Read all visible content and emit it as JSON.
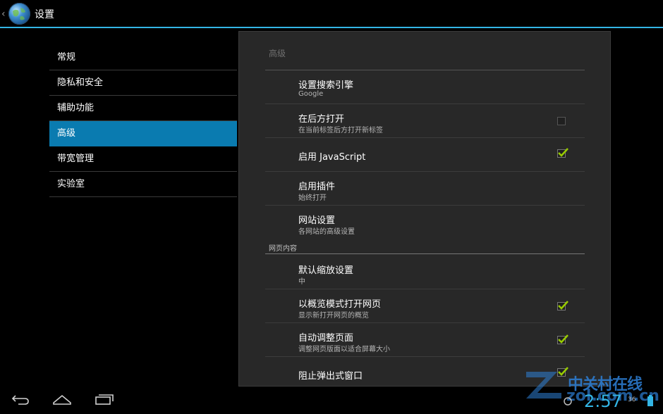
{
  "app": {
    "title": "设置"
  },
  "sidebar": {
    "items": [
      {
        "label": "常规",
        "selected": false
      },
      {
        "label": "隐私和安全",
        "selected": false
      },
      {
        "label": "辅助功能",
        "selected": false
      },
      {
        "label": "高级",
        "selected": true
      },
      {
        "label": "带宽管理",
        "selected": false
      },
      {
        "label": "实验室",
        "selected": false
      }
    ]
  },
  "panel": {
    "title": "高级",
    "prefs": [
      {
        "title": "设置搜索引擎",
        "summary": "Google"
      },
      {
        "title": "在后方打开",
        "summary": "在当前标签后方打开新标签",
        "checked": false
      },
      {
        "title": "启用 JavaScript",
        "checked": true
      },
      {
        "title": "启用插件",
        "summary": "始终打开"
      },
      {
        "title": "网站设置",
        "summary": "各网站的高级设置"
      }
    ],
    "category": "网页内容",
    "prefs2": [
      {
        "title": "默认缩放设置",
        "summary": "中"
      },
      {
        "title": "以概览模式打开网页",
        "summary": "显示新打开网页的概览",
        "checked": true
      },
      {
        "title": "自动调整页面",
        "summary": "调整网页版面以适合屏幕大小",
        "checked": true
      },
      {
        "title": "阻止弹出式窗口",
        "checked": true
      }
    ]
  },
  "statusbar": {
    "clock": "2:57",
    "indicator": "36"
  },
  "watermark": {
    "text": "中关村在线",
    "url": "zol.com.cn"
  },
  "colors": {
    "accent": "#33b5e5",
    "selected": "#0a7bb0",
    "checkmark": "#99cc00"
  }
}
